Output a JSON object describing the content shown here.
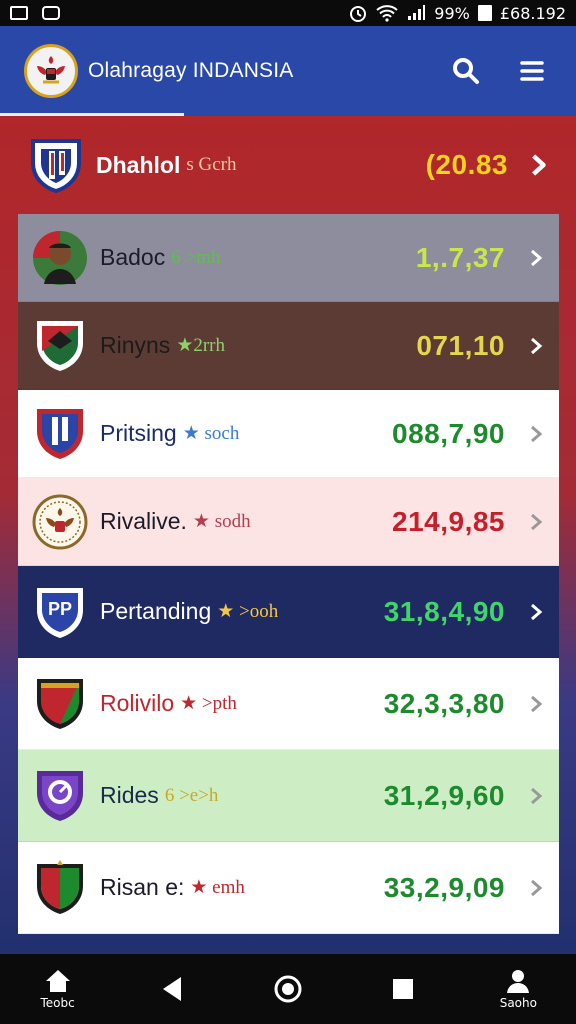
{
  "status_bar": {
    "battery": "99%",
    "time": "£68.192",
    "icons": [
      "image-icon",
      "mail-icon",
      "alarm-icon",
      "wifi-icon",
      "signal-icon",
      "battery-icon"
    ]
  },
  "header": {
    "title": "Olahragay INDANSIA",
    "icons": [
      "search-icon",
      "menu-icon"
    ]
  },
  "colors": {
    "header_bg": "#2948a8",
    "featured_value": "#f5d21b",
    "green_value": "#1e8a2e",
    "red_value": "#c41f2b"
  },
  "featured": {
    "name": "Dhahlol",
    "sub": "s Gcrh",
    "value": "(20.83"
  },
  "rows": [
    {
      "name": "Badoc",
      "sub": "6 >mh",
      "value": "1,.7,37"
    },
    {
      "name": "Rinyns",
      "sub": "★2rrh",
      "value": "071,10"
    },
    {
      "name": "Pritsing",
      "sub": "★ soch",
      "value": "088,7,90"
    },
    {
      "name": "Rivalive.",
      "sub": "★ sodh",
      "value": "214,9,85"
    },
    {
      "name": "Pertanding",
      "sub": "★ ˃ooh",
      "value": "31,8,4,90",
      "badge_text": "PP"
    },
    {
      "name": "Rolivilo",
      "sub": "★ ˃pth",
      "value": "32,3,3,80"
    },
    {
      "name": "Rides",
      "sub": "6 >e>h",
      "value": "31,2,9,60"
    },
    {
      "name": "Risan e:",
      "sub": "★ emh",
      "value": "33,2,9,09"
    }
  ],
  "navbar": {
    "items": [
      {
        "label": "Teobc",
        "icon": "home-icon"
      },
      {
        "label": "",
        "icon": "back-icon"
      },
      {
        "label": "",
        "icon": "home-circle-icon"
      },
      {
        "label": "",
        "icon": "recents-icon"
      },
      {
        "label": "Saoho",
        "icon": "profile-icon"
      }
    ]
  }
}
